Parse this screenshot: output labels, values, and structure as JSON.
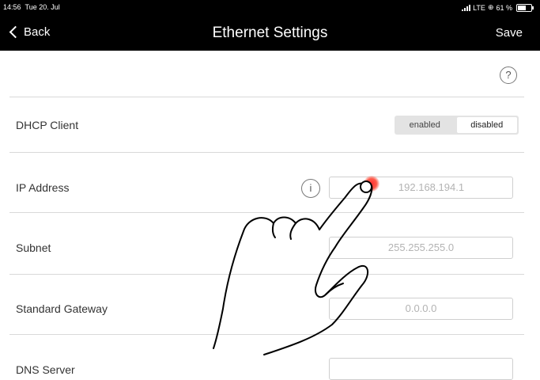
{
  "status_bar": {
    "time": "14:56",
    "date": "Tue 20. Jul",
    "network": "LTE",
    "battery_text": "61 %",
    "battery_level": 0.61
  },
  "nav": {
    "back_label": "Back",
    "title": "Ethernet Settings",
    "save_label": "Save"
  },
  "help_symbol": "?",
  "dhcp": {
    "label": "DHCP Client",
    "options": [
      "enabled",
      "disabled"
    ],
    "selected": "disabled"
  },
  "ip": {
    "label": "IP Address",
    "info_symbol": "i",
    "placeholder": "192.168.194.1"
  },
  "subnet": {
    "label": "Subnet",
    "placeholder": "255.255.255.0"
  },
  "gateway": {
    "label": "Standard Gateway",
    "placeholder": "0.0.0.0"
  },
  "dns": {
    "label": "DNS Server",
    "placeholder": ""
  },
  "colors": {
    "bar_background": "#000000",
    "touch_indicator": "#ff3030"
  }
}
